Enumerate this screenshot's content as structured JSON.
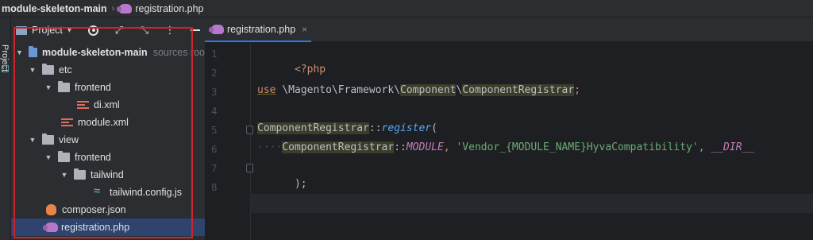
{
  "breadcrumb": {
    "root": "module-skeleton-main",
    "separator": "›",
    "file": "registration.php"
  },
  "tool_strip": {
    "label": "Project"
  },
  "project_panel": {
    "title": "Project",
    "tree": [
      {
        "label": "module-skeleton-main",
        "suffix": "sources roo"
      },
      {
        "label": "etc"
      },
      {
        "label": "frontend"
      },
      {
        "label": "di.xml"
      },
      {
        "label": "module.xml"
      },
      {
        "label": "view"
      },
      {
        "label": "frontend"
      },
      {
        "label": "tailwind"
      },
      {
        "label": "tailwind.config.js"
      },
      {
        "label": "composer.json"
      },
      {
        "label": "registration.php"
      }
    ]
  },
  "editor": {
    "tab_label": "registration.php",
    "tab_close": "×",
    "line_numbers": [
      "1",
      "2",
      "3",
      "4",
      "5",
      "6",
      "7",
      "8"
    ],
    "code": {
      "l1": "<?php",
      "l3_use": "use",
      "l3_ns": " \\Magento\\Framework\\",
      "l3_component": "Component",
      "l3_sep": "\\",
      "l3_registrar": "ComponentRegistrar",
      "l3_semi": ";",
      "l5_cls": "ComponentRegistrar",
      "l5_op": "::",
      "l5_fn": "register",
      "l5_paren": "(",
      "l6_indent": "····",
      "l6_cls": "ComponentRegistrar",
      "l6_op": "::",
      "l6_const": "MODULE",
      "l6_comma": ", ",
      "l6_str": "'Vendor_{MODULE_NAME}HyvaCompatibility'",
      "l6_comma2": ", ",
      "l6_dir": "__DIR__",
      "l7": ");"
    }
  },
  "colors": {
    "background": "#1e1f22",
    "panel": "#2b2d30",
    "selection": "#2e436e",
    "highlight_box": "#d4222a",
    "keyword": "#cf8e6d",
    "string": "#6aab73",
    "function": "#56a8f5"
  }
}
